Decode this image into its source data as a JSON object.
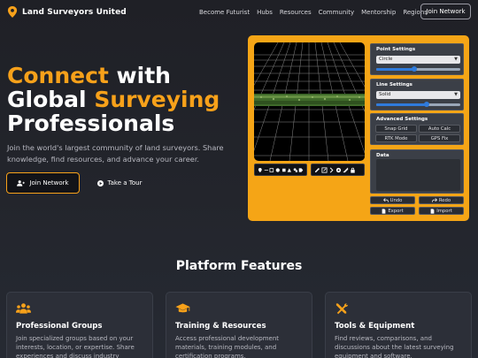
{
  "brand": {
    "name": "Land Surveyors United",
    "logo_icon": "map-pin-icon",
    "accent": "#f7a11a"
  },
  "nav": {
    "links": [
      "Become Futurist",
      "Hubs",
      "Resources",
      "Community",
      "Mentorship",
      "Regions"
    ],
    "join_label": "Join Network"
  },
  "hero": {
    "line1_hl": "Connect",
    "line1_rest": " with",
    "line2_pre": "Global ",
    "line2_hl": "Surveying",
    "line3": "Professionals",
    "subtitle": "Join the world's largest community of land surveyors. Share knowledge, find resources, and advance your career.",
    "primary_cta": "Join Network",
    "secondary_cta": "Take a Tour"
  },
  "app": {
    "point_settings": {
      "title": "Point Settings",
      "selected": "Circle",
      "slider_level": 0.45
    },
    "line_settings": {
      "title": "Line Settings",
      "selected": "Solid",
      "slider_level": 0.6
    },
    "advanced": {
      "title": "Advanced Settings",
      "buttons": [
        "Snap Grid",
        "Auto Calc",
        "RTK Mode",
        "GPS Fix"
      ]
    },
    "data": {
      "title": "Data"
    },
    "actions": {
      "undo": "Undo",
      "redo": "Redo",
      "export": "Export",
      "import": "Import"
    }
  },
  "features": {
    "title": "Platform Features",
    "cards": [
      {
        "icon": "users-icon",
        "title": "Professional Groups",
        "desc": "Join specialized groups based on your interests, location, or expertise. Share experiences and discuss industry"
      },
      {
        "icon": "graduation-cap-icon",
        "title": "Training & Resources",
        "desc": "Access professional development materials, training modules, and certification programs."
      },
      {
        "icon": "tools-icon",
        "title": "Tools & Equipment",
        "desc": "Find reviews, comparisons, and discussions about the latest surveying equipment and software."
      }
    ]
  }
}
